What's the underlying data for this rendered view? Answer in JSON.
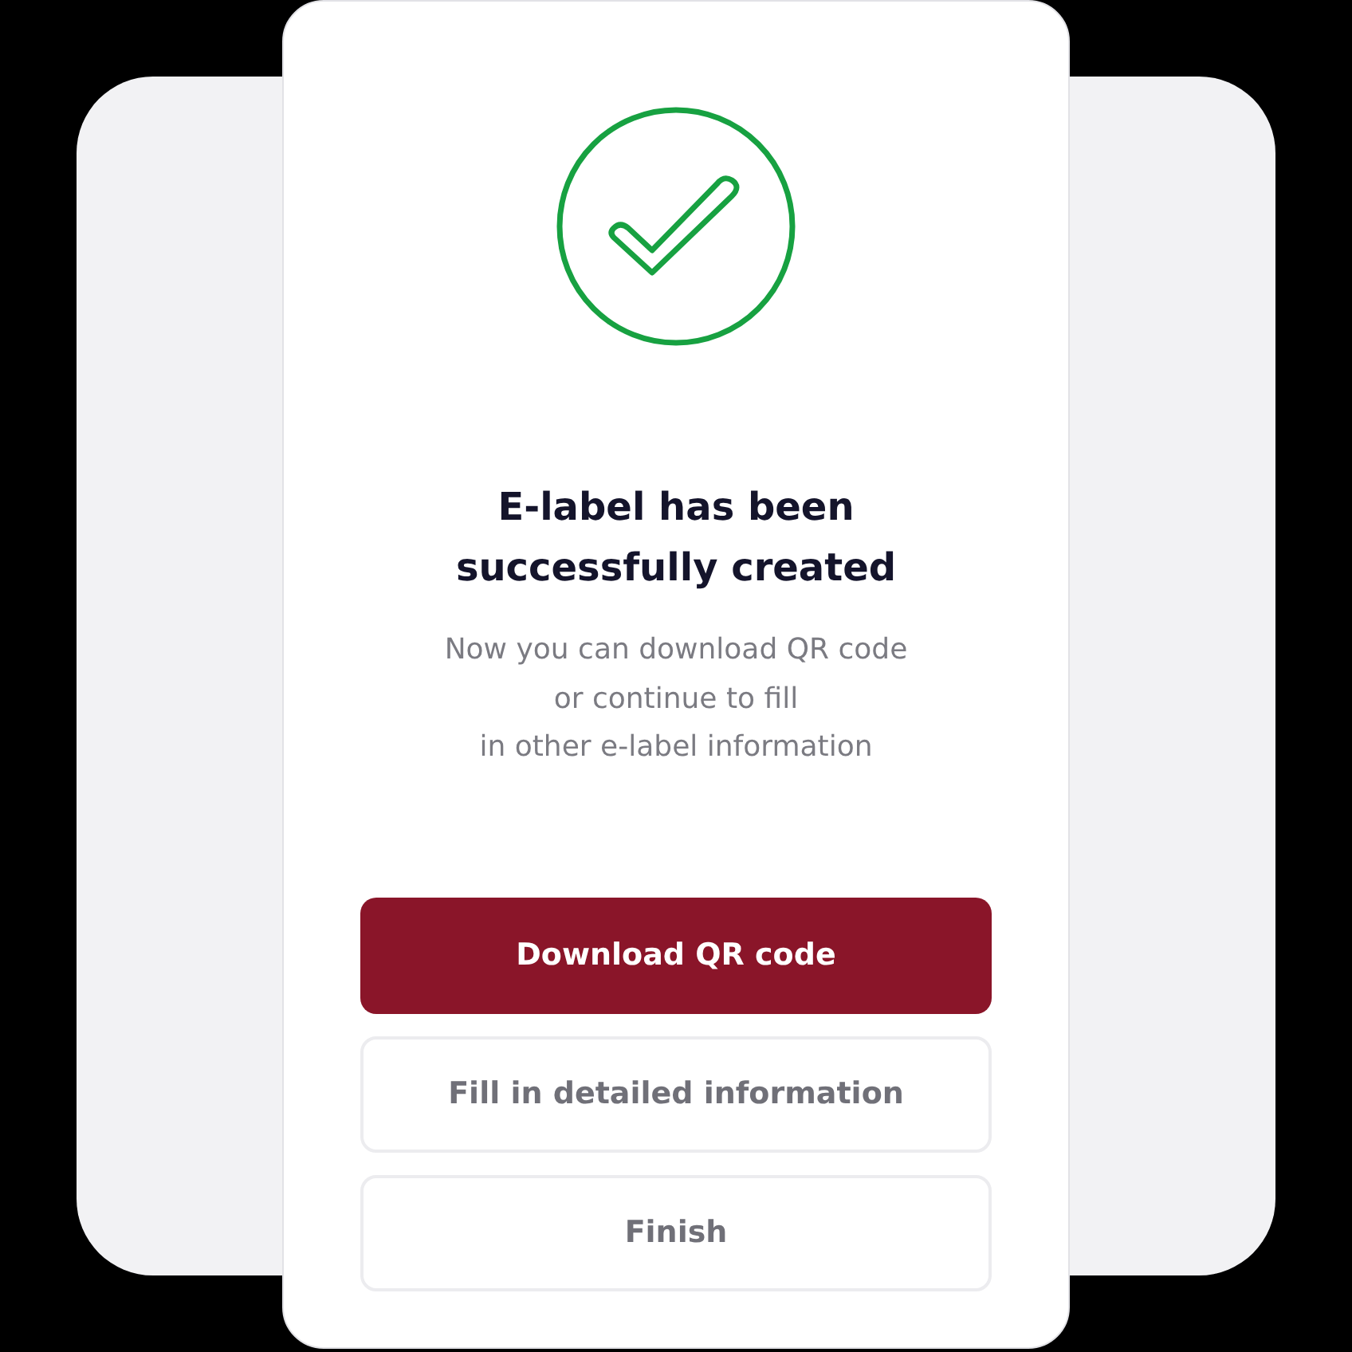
{
  "dialog": {
    "success": true,
    "title_lines": [
      "E-label has been",
      "successfully created"
    ],
    "message_lines": [
      "Now you can download QR code",
      "or continue to fill",
      "in other e-label information"
    ],
    "buttons": [
      {
        "label": "Download QR code",
        "kind": "primary"
      },
      {
        "label": "Fill in detailed information",
        "kind": "secondary"
      },
      {
        "label": "Finish",
        "kind": "secondary"
      }
    ]
  }
}
